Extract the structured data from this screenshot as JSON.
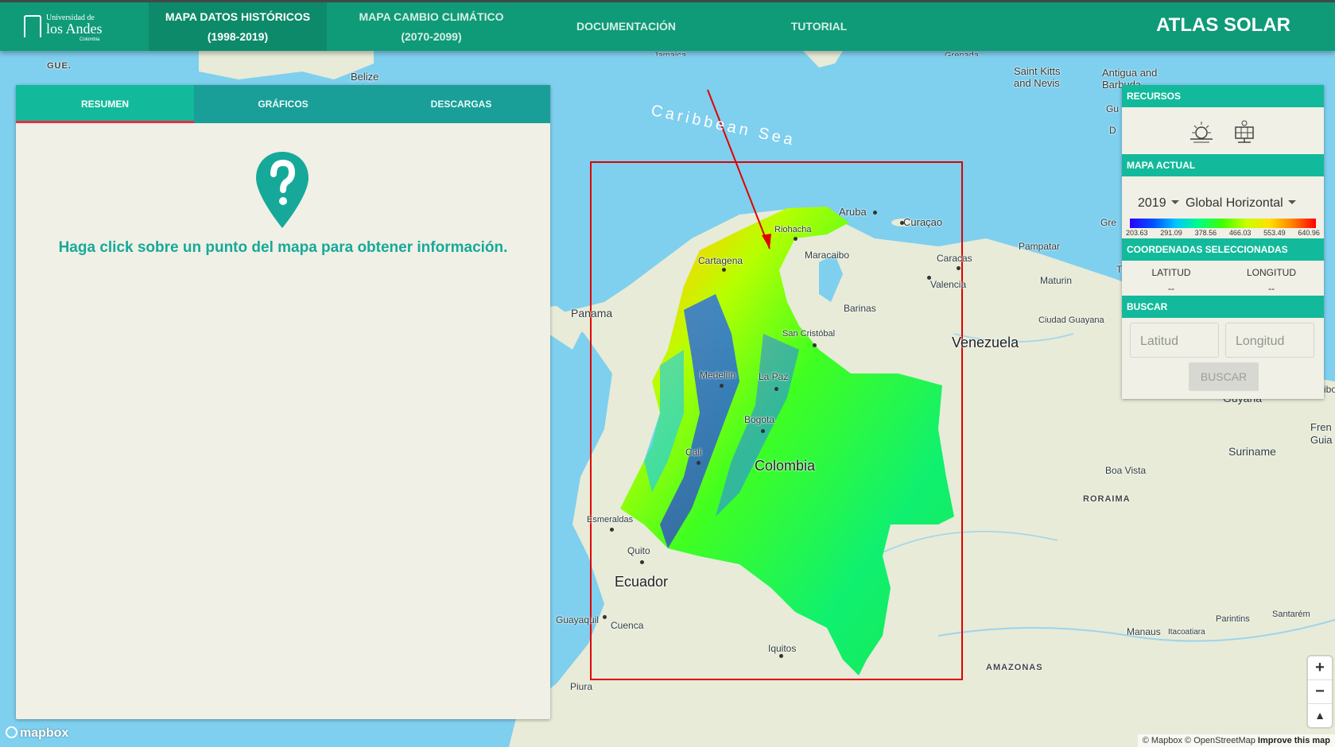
{
  "nav": {
    "logo": {
      "line1": "Universidad de",
      "line2": "los Andes",
      "line3": "Colombia"
    },
    "items": [
      {
        "line1": "MAPA DATOS HISTÓRICOS",
        "line2": "(1998-2019)"
      },
      {
        "line1": "MAPA CAMBIO CLIMÁTICO",
        "line2": "(2070-2099)"
      },
      {
        "line1": "DOCUMENTACIÓN",
        "line2": ""
      },
      {
        "line1": "TUTORIAL",
        "line2": ""
      }
    ],
    "brand": "ATLAS SOLAR"
  },
  "panel": {
    "tabs": [
      "RESUMEN",
      "GRÁFICOS",
      "DESCARGAS"
    ],
    "message": "Haga click sobre un punto del mapa para obtener información."
  },
  "side": {
    "recursos": "RECURSOS",
    "mapa_actual": "MAPA ACTUAL",
    "year": "2019",
    "variable": "Global Horizontal",
    "scale_ticks": [
      "203.63",
      "291.09",
      "378.56",
      "466.03",
      "553.49",
      "640.96"
    ],
    "coordenadas": "COORDENADAS SELECCIONADAS",
    "latitud_label": "LATITUD",
    "longitud_label": "LONGITUD",
    "lat_value": "--",
    "lon_value": "--",
    "buscar": "BUSCAR",
    "lat_placeholder": "Latitud",
    "lon_placeholder": "Longitud",
    "buscar_button": "BUSCAR"
  },
  "map": {
    "labels": [
      "Caribbean Sea",
      "Aruba",
      "Curaçao",
      "Riohacha",
      "Cartagena",
      "Maracaibo",
      "Caracas",
      "Valencia",
      "Barinas",
      "Panama",
      "San Cristóbal",
      "Venezuela",
      "Medellín",
      "La Paz",
      "Bogota",
      "Cali",
      "Colombia",
      "Esmeraldas",
      "Quito",
      "Ecuador",
      "Guayaquil",
      "Cuenca",
      "Iquitos",
      "Piura",
      "Pampatar",
      "Maturin",
      "Ciudad Guayana",
      "Guyana",
      "Suriname",
      "Boa Vista",
      "RORAIMA",
      "AMAZONAS",
      "Manaus",
      "Itacoatiara",
      "Parintins",
      "Santarém",
      "Saint Kitts and Nevis",
      "Antigua and Barbuda",
      "Belize",
      "GUE.",
      "Jamaica",
      "Grenada",
      "Gu",
      "D",
      "Gre",
      "T",
      "ibo",
      "Fren Guia"
    ],
    "mapbox_logo": "mapbox",
    "attribution": "© Mapbox © OpenStreetMap",
    "improve": "Improve this map",
    "zoom_in": "+",
    "zoom_out": "−"
  }
}
